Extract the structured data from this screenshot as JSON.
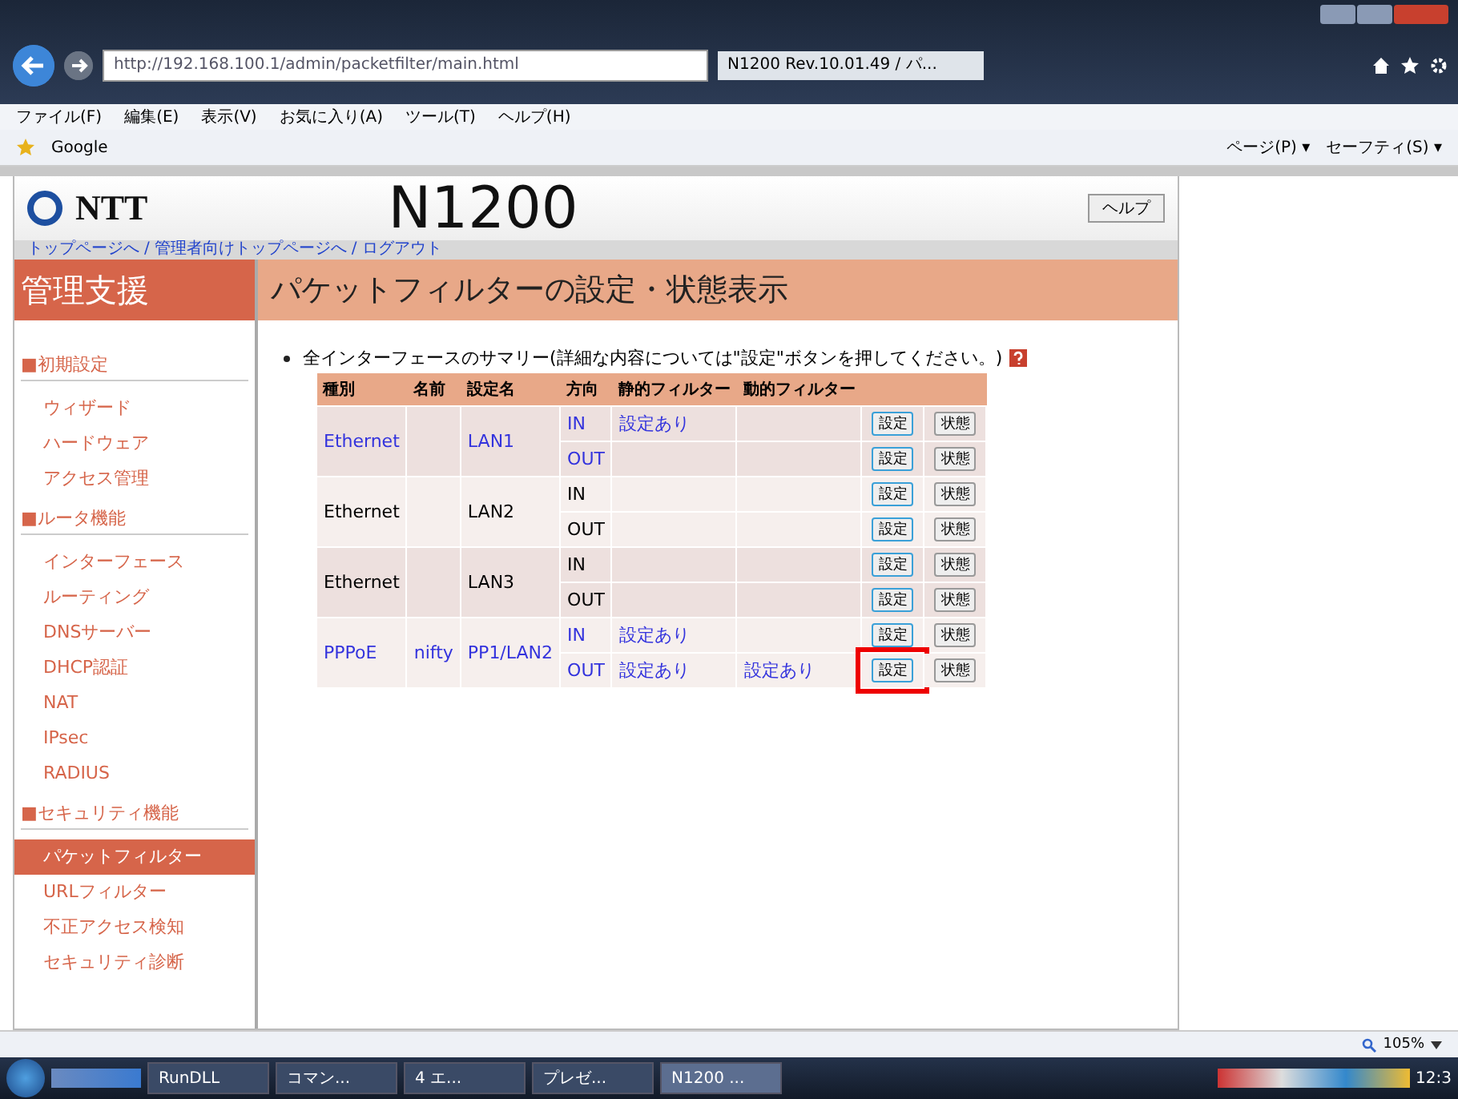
{
  "browser": {
    "address": "http://192.168.100.1/admin/packetfilter/main.html",
    "tab_title": "N1200 Rev.10.01.49 / パ...",
    "menu": [
      "ファイル(F)",
      "編集(E)",
      "表示(V)",
      "お気に入り(A)",
      "ツール(T)",
      "ヘルプ(H)"
    ],
    "favorites": [
      "Google"
    ],
    "command_bar": [
      "ページ(P) ▾",
      "セーフティ(S) ▾"
    ]
  },
  "header": {
    "logo": "NTT",
    "model": "N1200",
    "help_button": "ヘルプ",
    "breadcrumbs": [
      "トップページへ",
      "管理者向けトップページへ",
      "ログアウト"
    ],
    "breadcrumb_separator": "/"
  },
  "sidebar": {
    "title": "管理支援",
    "sections": [
      {
        "heading": "■初期設定",
        "items": [
          {
            "label": "ウィザード",
            "selected": false
          },
          {
            "label": "ハードウェア",
            "selected": false
          },
          {
            "label": "アクセス管理",
            "selected": false
          }
        ]
      },
      {
        "heading": "■ルータ機能",
        "items": [
          {
            "label": "インターフェース",
            "selected": false
          },
          {
            "label": "ルーティング",
            "selected": false
          },
          {
            "label": "DNSサーバー",
            "selected": false
          },
          {
            "label": "DHCP認証",
            "selected": false
          },
          {
            "label": "NAT",
            "selected": false
          },
          {
            "label": "IPsec",
            "selected": false
          },
          {
            "label": "RADIUS",
            "selected": false
          }
        ]
      },
      {
        "heading": "■セキュリティ機能",
        "items": [
          {
            "label": "パケットフィルター",
            "selected": true
          },
          {
            "label": "URLフィルター",
            "selected": false
          },
          {
            "label": "不正アクセス検知",
            "selected": false
          },
          {
            "label": "セキュリティ診断",
            "selected": false
          }
        ]
      }
    ]
  },
  "main": {
    "title": "パケットフィルターの設定・状態表示",
    "summary": "全インターフェースのサマリー(詳細な内容については\"設定\"ボタンを押してください。)",
    "table": {
      "columns": [
        "種別",
        "名前",
        "設定名",
        "方向",
        "静的フィルター",
        "動的フィルター"
      ],
      "groups": [
        {
          "type": "Ethernet",
          "setting": "LAN1",
          "link": true,
          "rows": [
            {
              "dir": "IN",
              "static": "設定あり",
              "dynamic": "",
              "setting_button": "設定",
              "status_button": "状態",
              "highlighted": false
            },
            {
              "dir": "OUT",
              "static": "",
              "dynamic": "",
              "setting_button": "設定",
              "status_button": "状態",
              "highlighted": false
            }
          ]
        },
        {
          "type": "Ethernet",
          "setting": "LAN2",
          "link": false,
          "rows": [
            {
              "dir": "IN",
              "static": "",
              "dynamic": "",
              "setting_button": "設定",
              "status_button": "状態",
              "highlighted": false
            },
            {
              "dir": "OUT",
              "static": "",
              "dynamic": "",
              "setting_button": "設定",
              "status_button": "状態",
              "highlighted": false
            }
          ]
        },
        {
          "type": "Ethernet",
          "setting": "LAN3",
          "link": false,
          "rows": [
            {
              "dir": "IN",
              "static": "",
              "dynamic": "",
              "setting_button": "設定",
              "status_button": "状態",
              "highlighted": false
            },
            {
              "dir": "OUT",
              "static": "",
              "dynamic": "",
              "setting_button": "設定",
              "status_button": "状態",
              "highlighted": false
            }
          ]
        },
        {
          "type": "PPPoE",
          "name": "nifty",
          "setting": "PP1/LAN2",
          "link": true,
          "rows": [
            {
              "dir": "IN",
              "static": "設定あり",
              "dynamic": "",
              "setting_button": "設定",
              "status_button": "状態",
              "highlighted": false
            },
            {
              "dir": "OUT",
              "static": "設定あり",
              "dynamic": "設定あり",
              "setting_button": "設定",
              "status_button": "状態",
              "highlighted": true
            }
          ]
        }
      ]
    }
  },
  "status_bar": {
    "zoom": "105%"
  },
  "taskbar": {
    "items": [
      {
        "label": "RunDLL",
        "selected": false
      },
      {
        "label": "コマン...",
        "selected": false
      },
      {
        "label": "4 エ...",
        "selected": false
      },
      {
        "label": "プレゼ...",
        "selected": false
      },
      {
        "label": "N1200 ...",
        "selected": true
      }
    ],
    "clock": "12:3"
  }
}
